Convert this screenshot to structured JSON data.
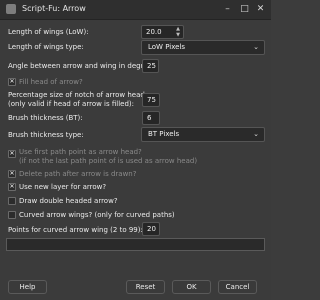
{
  "window": {
    "title": "Script-Fu: Arrow",
    "controls": [
      "–",
      "□",
      "✕"
    ]
  },
  "form": {
    "length_wings_label": "Length of wings (LoW):",
    "length_wings_value": "20.0",
    "length_wings_type_label": "Length of wings type:",
    "length_wings_type_value": "LoW Pixels",
    "angle_label": "Angle between arrow and wing in degrees:",
    "angle_value": "25",
    "fill_head_label": "Fill head of arrow?",
    "fill_head_checked": true,
    "notch_label_line1": "Percentage size of notch of arrow head",
    "notch_label_line2": "(only valid if head of arrow is filled):",
    "notch_value": "75",
    "brush_thickness_label": "Brush thickness (BT):",
    "brush_thickness_value": "6",
    "brush_type_label": "Brush thickness type:",
    "brush_type_value": "BT Pixels",
    "first_point_label_line1": "Use first path point as arrow head?",
    "first_point_label_line2": "(if not the last path point of is used as arrow head)",
    "first_point_checked": true,
    "delete_path_label": "Delete path after arrow is drawn?",
    "delete_path_checked": true,
    "new_layer_label": "Use new layer for arrow?",
    "new_layer_checked": true,
    "double_headed_label": "Draw double headed arrow?",
    "double_headed_checked": false,
    "curved_wings_label": "Curved arrow wings? (only for curved paths)",
    "curved_wings_checked": false,
    "points_curved_label": "Points for curved arrow wing (2 to 99):",
    "points_curved_value": "20"
  },
  "buttons": {
    "help": "Help",
    "reset": "Reset",
    "ok": "OK",
    "cancel": "Cancel"
  }
}
